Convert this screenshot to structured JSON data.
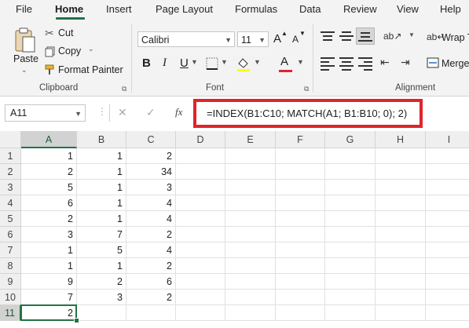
{
  "menu": {
    "tabs": [
      {
        "label": "File"
      },
      {
        "label": "Home"
      },
      {
        "label": "Insert"
      },
      {
        "label": "Page Layout"
      },
      {
        "label": "Formulas"
      },
      {
        "label": "Data"
      },
      {
        "label": "Review"
      },
      {
        "label": "View"
      },
      {
        "label": "Help"
      }
    ],
    "active": "Home"
  },
  "ribbon": {
    "clipboard": {
      "paste_label": "Paste",
      "cut_label": "Cut",
      "copy_label": "Copy",
      "format_painter_label": "Format Painter",
      "group_label": "Clipboard"
    },
    "font": {
      "font_name": "Calibri",
      "font_size": "11",
      "bold_label": "B",
      "italic_label": "I",
      "underline_label": "U",
      "font_color_label": "A",
      "grow_label": "A",
      "shrink_label": "A",
      "group_label": "Font",
      "highlight_color": "#ffff00",
      "font_color": "#e0242b"
    },
    "alignment": {
      "wrap_label": "Wrap T",
      "merge_label": "Merge",
      "group_label": "Alignment"
    }
  },
  "formula_bar": {
    "name_box": "A11",
    "fx_label": "fx",
    "formula": "=INDEX(B1:C10; MATCH(A1; B1:B10; 0); 2)",
    "highlight_color": "#e0242b"
  },
  "sheet": {
    "columns": [
      "A",
      "B",
      "C",
      "D",
      "E",
      "F",
      "G",
      "H",
      "I"
    ],
    "rows": [
      "1",
      "2",
      "3",
      "4",
      "5",
      "6",
      "7",
      "8",
      "9",
      "10",
      "11"
    ],
    "cells": [
      [
        "1",
        "1",
        "2"
      ],
      [
        "2",
        "1",
        "34"
      ],
      [
        "5",
        "1",
        "3"
      ],
      [
        "6",
        "1",
        "4"
      ],
      [
        "2",
        "1",
        "4"
      ],
      [
        "3",
        "7",
        "2"
      ],
      [
        "1",
        "5",
        "4"
      ],
      [
        "1",
        "1",
        "2"
      ],
      [
        "9",
        "2",
        "6"
      ],
      [
        "7",
        "3",
        "2"
      ],
      [
        "2",
        "",
        ""
      ]
    ],
    "active_cell": "A11",
    "accent": "#217346"
  }
}
